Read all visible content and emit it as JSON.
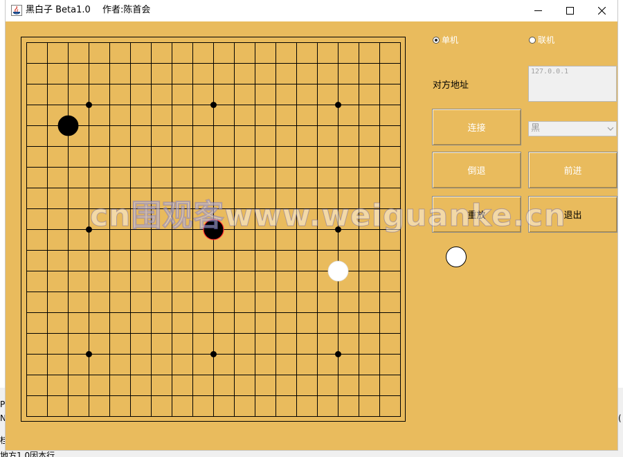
{
  "window": {
    "title": "黑白子 Beta1.0",
    "author": "作者:陈首会"
  },
  "board": {
    "size": 19,
    "line_color": "#000000",
    "background": "#e9bb5d",
    "star_points": [
      [
        3,
        3
      ],
      [
        9,
        3
      ],
      [
        15,
        3
      ],
      [
        3,
        9
      ],
      [
        9,
        9
      ],
      [
        15,
        9
      ],
      [
        3,
        15
      ],
      [
        9,
        15
      ],
      [
        15,
        15
      ]
    ],
    "stones": [
      {
        "col": 2,
        "row": 4,
        "color": "black",
        "last": false
      },
      {
        "col": 9,
        "row": 9,
        "color": "black",
        "last": true
      },
      {
        "col": 15,
        "row": 11,
        "color": "white",
        "last": false
      }
    ]
  },
  "panel": {
    "mode_single": "单机",
    "mode_online": "联机",
    "address_label": "对方地址",
    "address_value": "127.0.0.1",
    "connect_label": "连接",
    "color_select": "黑",
    "undo_label": "倒退",
    "redo_label": "前进",
    "replay_label": "重放",
    "exit_label": "退出",
    "current_turn": "white"
  },
  "watermark": "cn围观客www.weiguanke.cn",
  "background_fragments": {
    "a": "P",
    "b": "N",
    "c": "桂",
    "d": "地方1.0因本行",
    "e": "("
  },
  "colors": {
    "accent": "#e9bb5d",
    "stone_black": "#000000",
    "stone_white": "#ffffff",
    "last_move_ring": "#ff2a2a"
  }
}
